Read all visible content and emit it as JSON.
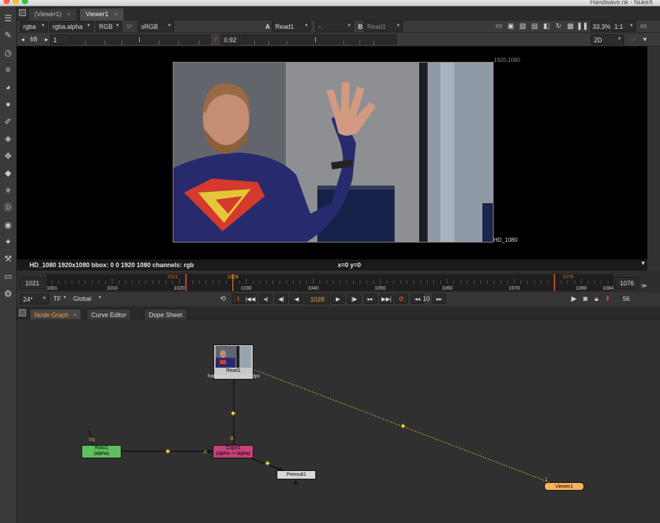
{
  "window": {
    "title": "Handwave.nk - NukeX"
  },
  "viewer_tabs": [
    {
      "label": "(Viewer1)",
      "active": false
    },
    {
      "label": "Viewer1",
      "active": true
    }
  ],
  "viewer_controls_row1": {
    "channels": "rgba",
    "alpha_channel": "rgba.alpha",
    "display_channel": "RGB",
    "ip_label": "IP",
    "colorspace": "sRGB",
    "input_a_label": "A",
    "input_a": "Read1",
    "operation": "-",
    "input_b_label": "B",
    "input_b": "Read1",
    "zoom": "33.3%",
    "ratio": "1:1"
  },
  "viewer_controls_row2": {
    "fstop": "f/8",
    "gain_value": "1",
    "gamma_label": "Y",
    "gamma_value": "0.92",
    "view_mode": "2D"
  },
  "gain_slider": {
    "ticks": [
      "0.03125",
      "0.1",
      "0.3",
      "1",
      "4",
      "16",
      "64"
    ]
  },
  "gamma_slider": {
    "ticks": [
      "0.2",
      "0.3",
      "0.5",
      "1",
      "2",
      "3",
      "4"
    ]
  },
  "viewer": {
    "corner_label_top": "1920,1080",
    "corner_label_bottom": "HD_1080",
    "info_text": "HD_1080 1920x1080  bbox: 0 0 1920 1080 channels: rgb",
    "coords_text": "x=0 y=0"
  },
  "timeline": {
    "start_field": "1021",
    "end_field": "1076",
    "in_marker": "1021",
    "current_marker": "1028",
    "out_marker": "1076",
    "labels": [
      "1001",
      "1010",
      "1020",
      "1030",
      "1040",
      "1050",
      "1060",
      "1070",
      "1080",
      "1084"
    ],
    "range": [
      1001,
      1084
    ]
  },
  "playback": {
    "fps": "24*",
    "mode": "TF",
    "scope": "Global",
    "current_frame": "1028",
    "step": "10",
    "cache_count": "56"
  },
  "pane_tabs": [
    {
      "label": "Node Graph",
      "active": true
    },
    {
      "label": "Curve Editor",
      "active": false
    },
    {
      "label": "Dope Sheet",
      "active": false
    }
  ],
  "nodes": {
    "read": {
      "name": "Read1",
      "file": "handwave_01.1028.dpx"
    },
    "roto": {
      "name": "Roto1",
      "sub": "(alpha)"
    },
    "copy": {
      "name": "Copy1",
      "sub": "(alpha -> alpha)"
    },
    "premult": {
      "name": "Premult1"
    },
    "viewer": {
      "name": "Viewer1"
    },
    "input_labels": {
      "bg": "bg",
      "b": "B",
      "a": "A",
      "viewer_in": "1"
    }
  },
  "icons": {
    "toolbar": [
      "node-graph-icon",
      "paint-icon",
      "time-icon",
      "channel-icon",
      "color-icon",
      "filter-icon",
      "draw-icon",
      "merge-icon",
      "transform-icon",
      "3d-icon",
      "particles-icon",
      "deep-icon",
      "views-icon",
      "metadata-icon",
      "toolsets-icon",
      "other-icon",
      "furnace-icon"
    ]
  },
  "colors": {
    "accent": "#f0a030",
    "roto_node": "#5fbf5f",
    "copy_node": "#c8427a",
    "viewer_node": "#f5b060",
    "premult_node": "#d8d8d8",
    "read_node": "#c8c8c8"
  }
}
